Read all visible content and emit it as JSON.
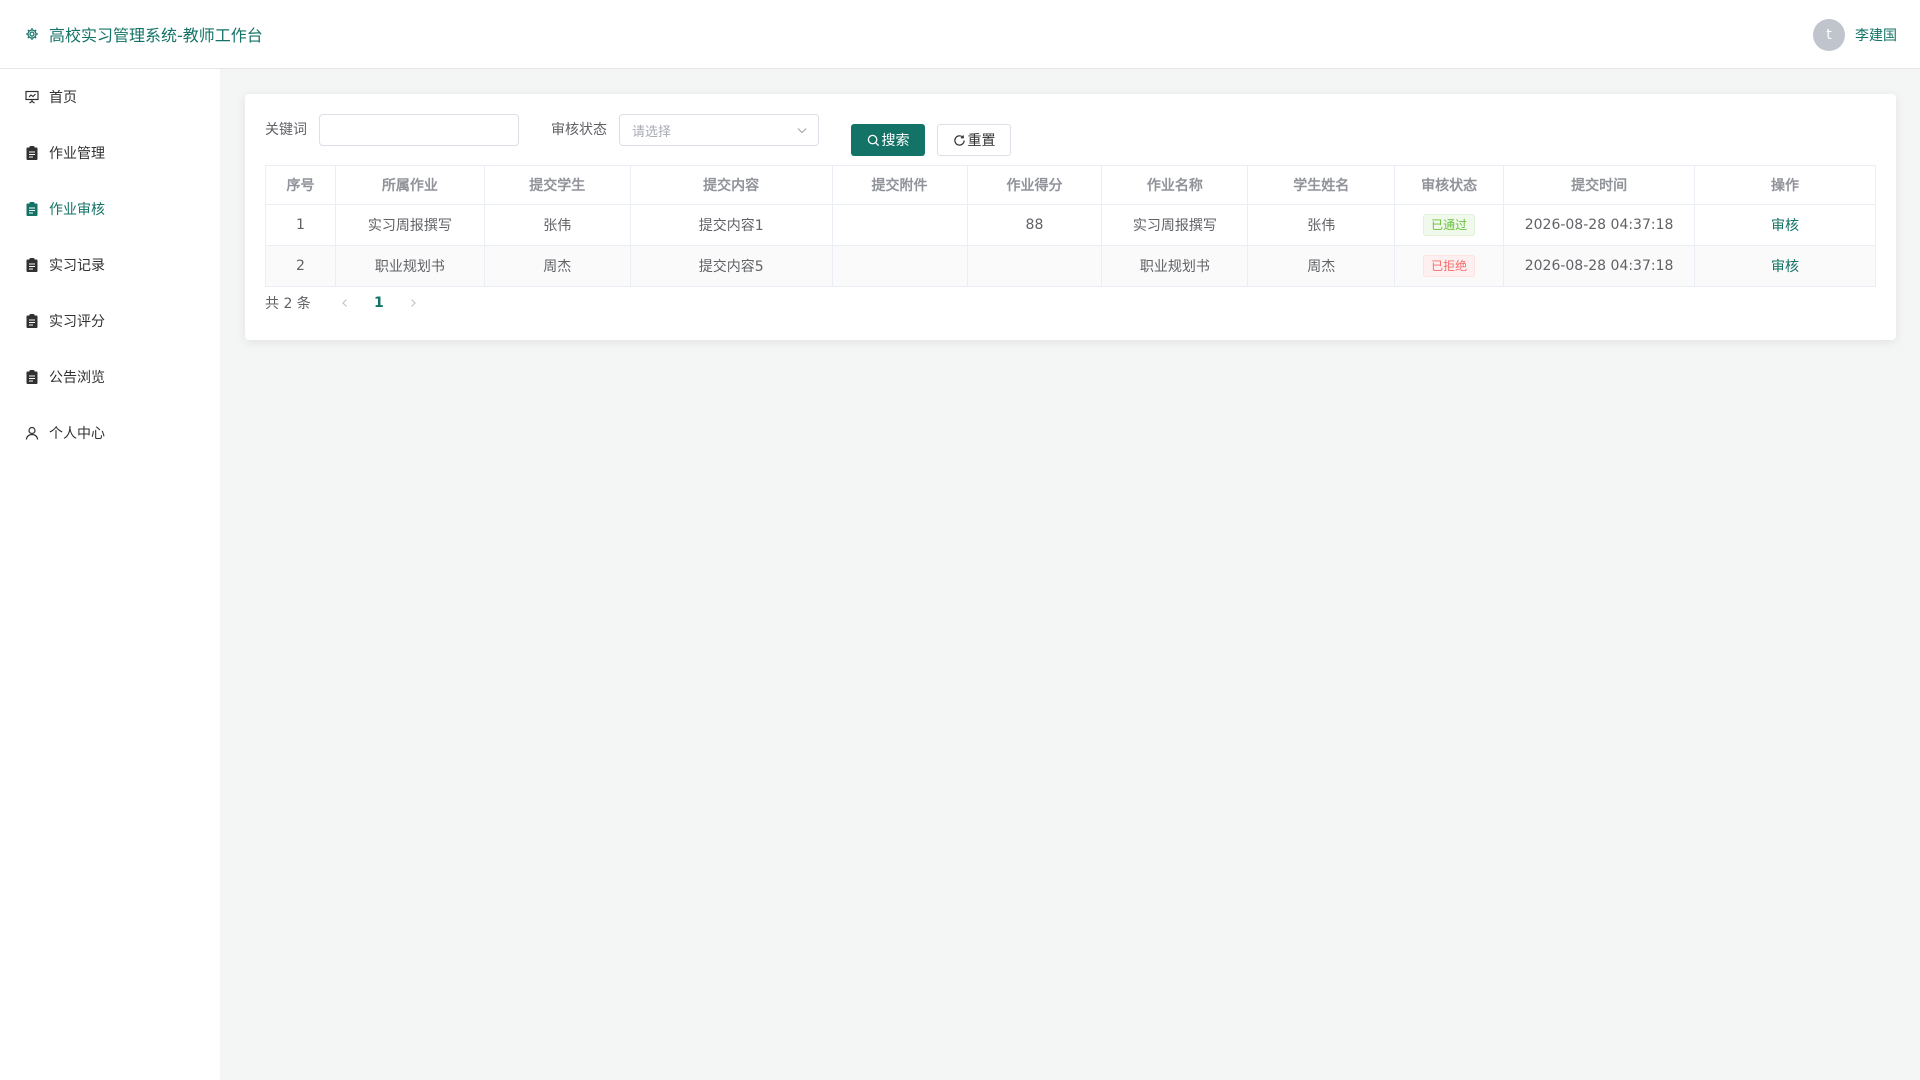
{
  "header": {
    "title": "高校实习管理系统-教师工作台",
    "avatar_letter": "t",
    "username": "李建国"
  },
  "sidebar": {
    "items": [
      {
        "label": "首页",
        "icon": "presentation-icon"
      },
      {
        "label": "作业管理",
        "icon": "clipboard-icon"
      },
      {
        "label": "作业审核",
        "icon": "clipboard-icon",
        "active": true
      },
      {
        "label": "实习记录",
        "icon": "clipboard-icon"
      },
      {
        "label": "实习评分",
        "icon": "clipboard-icon"
      },
      {
        "label": "公告浏览",
        "icon": "clipboard-icon"
      },
      {
        "label": "个人中心",
        "icon": "user-icon"
      }
    ]
  },
  "search": {
    "keyword_label": "关键词",
    "keyword_value": "",
    "status_label": "审核状态",
    "status_placeholder": "请选择",
    "search_button": "搜索",
    "reset_button": "重置"
  },
  "table": {
    "columns": [
      "序号",
      "所属作业",
      "提交学生",
      "提交内容",
      "提交附件",
      "作业得分",
      "作业名称",
      "学生姓名",
      "审核状态",
      "提交时间",
      "操作"
    ],
    "rows": [
      {
        "index": "1",
        "assignment": "实习周报撰写",
        "student": "张伟",
        "content": "提交内容1",
        "attachment": "",
        "score": "88",
        "name": "实习周报撰写",
        "student_name": "张伟",
        "status": "已通过",
        "status_type": "pass",
        "time": "2026-08-28 04:37:18",
        "action": "审核"
      },
      {
        "index": "2",
        "assignment": "职业规划书",
        "student": "周杰",
        "content": "提交内容5",
        "attachment": "",
        "score": "",
        "name": "职业规划书",
        "student_name": "周杰",
        "status": "已拒绝",
        "status_type": "reject",
        "time": "2026-08-28 04:37:18",
        "action": "审核"
      }
    ]
  },
  "pagination": {
    "total": "共 2 条",
    "current_page": "1"
  },
  "colors": {
    "primary": "#137366",
    "pass": "#67c23a",
    "reject": "#f56c6c",
    "background": "#f4f5f5"
  }
}
